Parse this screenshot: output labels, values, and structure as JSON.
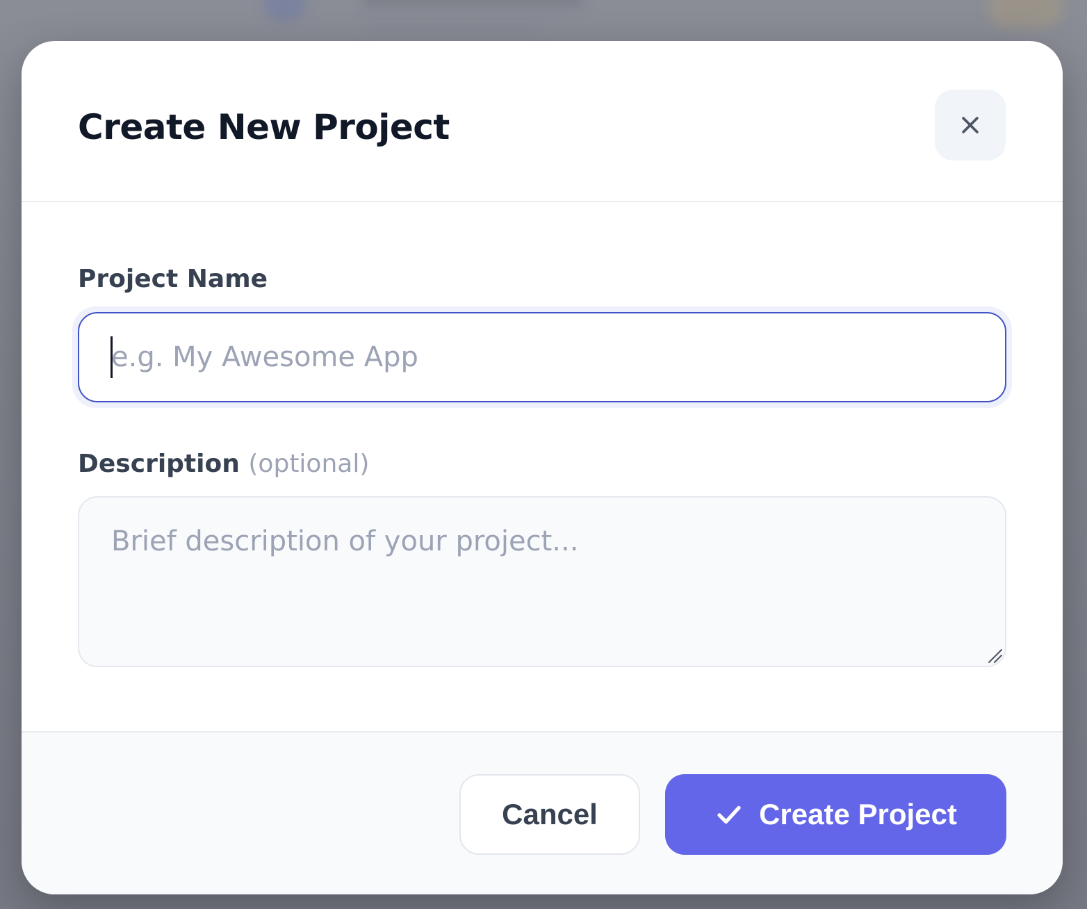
{
  "dialog": {
    "title": "Create New Project",
    "close_icon": "close-icon"
  },
  "form": {
    "name": {
      "label": "Project Name",
      "placeholder": "e.g. My Awesome App",
      "value": ""
    },
    "description": {
      "label": "Description",
      "optional_label": "(optional)",
      "placeholder": "Brief description of your project...",
      "value": ""
    }
  },
  "footer": {
    "cancel_label": "Cancel",
    "create_label": "Create Project",
    "create_icon": "check-icon"
  },
  "colors": {
    "primary": "#6366e8",
    "focus_border": "#4252c6",
    "title": "#111827",
    "label": "#374151",
    "placeholder": "#9ca3b4"
  }
}
